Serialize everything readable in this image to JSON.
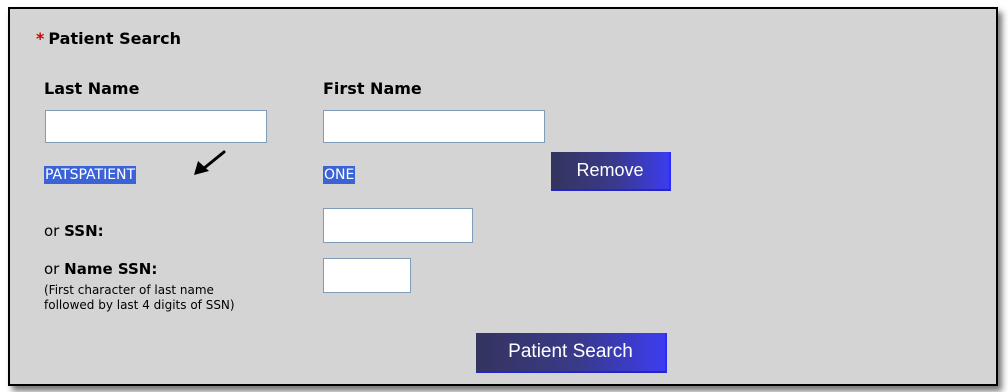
{
  "form": {
    "required_mark": "*",
    "title": "Patient Search",
    "last_name_label": "Last Name",
    "first_name_label": "First Name",
    "last_name_value": "",
    "first_name_value": "",
    "selected_last_name": "PATSPATIENT",
    "selected_first_name": "ONE",
    "remove_label": "Remove",
    "ssn_prefix": "or",
    "ssn_label": "SSN:",
    "ssn_value": "",
    "name_ssn_prefix": "or",
    "name_ssn_label": "Name SSN:",
    "name_ssn_hint_line1": "(First character of last name",
    "name_ssn_hint_line2": "followed by last 4 digits of SSN)",
    "name_ssn_value": "",
    "search_label": "Patient Search"
  },
  "colors": {
    "required": "#d00000",
    "selection": "#3b63d6",
    "panel_bg": "#d4d4d4"
  },
  "icons": {
    "annotation": "arrow-pointer-icon"
  }
}
